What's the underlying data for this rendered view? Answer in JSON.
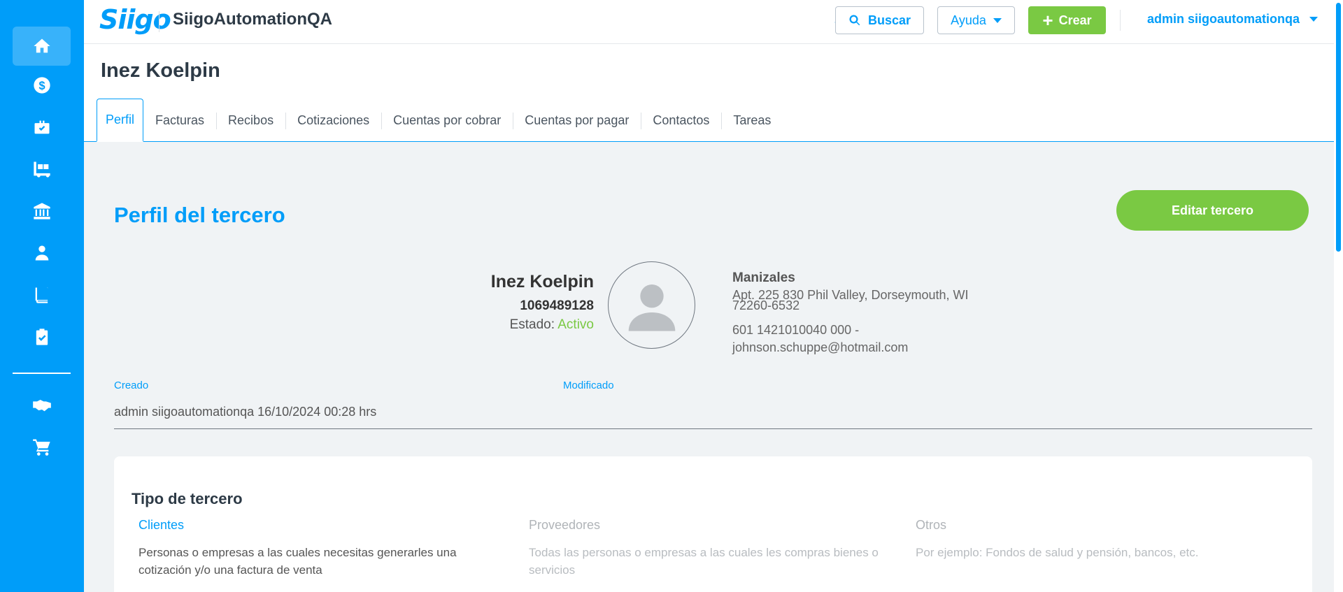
{
  "brand": {
    "logo_text": "Siigo",
    "company": "SiigoAutomationQA",
    "accent": "#009df9",
    "green": "#7ac943"
  },
  "sidebar": {
    "items": [
      {
        "icon": "home-icon",
        "active": true
      },
      {
        "icon": "dollar-icon"
      },
      {
        "icon": "briefcase-icon"
      },
      {
        "icon": "warehouse-icon"
      },
      {
        "icon": "bank-icon"
      },
      {
        "icon": "user-icon"
      },
      {
        "icon": "book-icon"
      },
      {
        "icon": "clipboard-check-icon"
      },
      {
        "icon": "handshake-icon"
      },
      {
        "icon": "cart-icon"
      }
    ]
  },
  "header": {
    "search_label": "Buscar",
    "help_label": "Ayuda",
    "create_label": "Crear",
    "user_name": "admin siigoautomationqa"
  },
  "page": {
    "title": "Inez Koelpin",
    "tabs": [
      "Perfil",
      "Facturas",
      "Recibos",
      "Cotizaciones",
      "Cuentas por cobrar",
      "Cuentas por pagar",
      "Contactos",
      "Tareas"
    ],
    "active_tab": "Perfil"
  },
  "profile": {
    "heading": "Perfil del tercero",
    "edit_label": "Editar tercero",
    "name": "Inez Koelpin",
    "id_number": "1069489128",
    "state_label": "Estado:",
    "state_value": "Activo",
    "city": "Manizales",
    "address": "Apt. 225 830 Phil Valley, Dorseymouth, WI 72260-6532",
    "phone": "601 1421010040 000 -",
    "email": "johnson.schuppe@hotmail.com",
    "created_label": "Creado",
    "modified_label": "Modificado",
    "created_value": "admin siigoautomationqa 16/10/2024 00:28 hrs"
  },
  "tipo_tercero": {
    "title": "Tipo de tercero",
    "options": [
      {
        "label": "Clientes",
        "desc": "Personas o empresas a las cuales necesitas generarles una cotización y/o una factura de venta",
        "selected": true
      },
      {
        "label": "Proveedores",
        "desc": "Todas las personas o empresas a las cuales les compras bienes o servicios",
        "selected": false
      },
      {
        "label": "Otros",
        "desc": "Por ejemplo: Fondos de salud y pensión, bancos, etc.",
        "selected": false
      }
    ]
  }
}
